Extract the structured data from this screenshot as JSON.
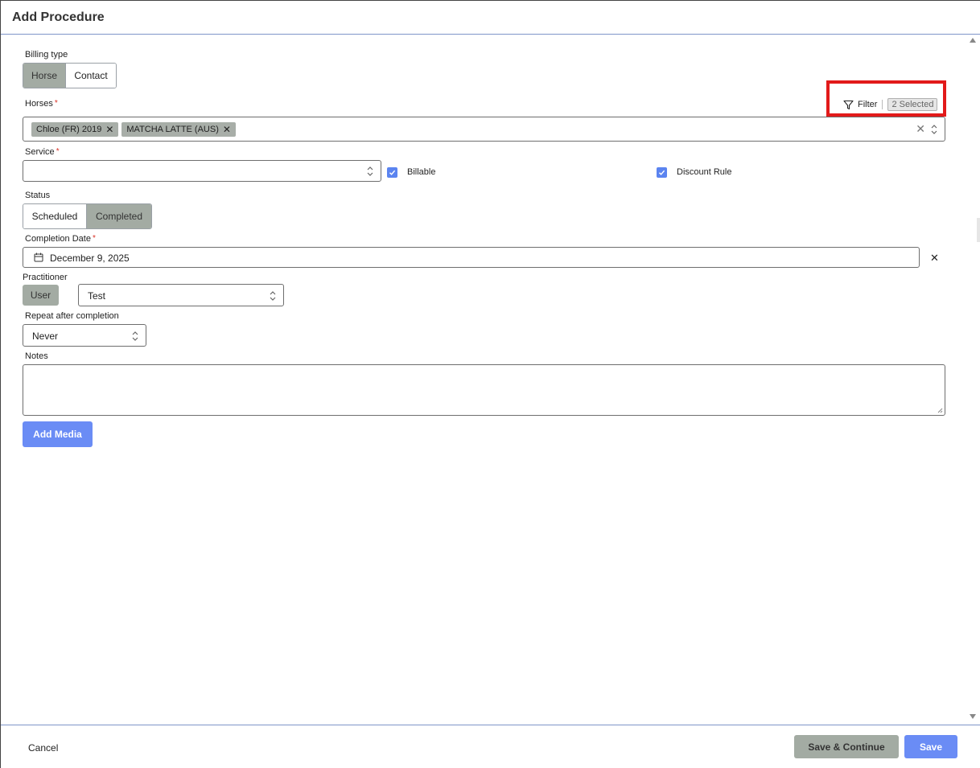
{
  "header": {
    "title": "Add Procedure"
  },
  "billing": {
    "label": "Billing type",
    "options": [
      "Horse",
      "Contact"
    ],
    "selected": "Horse"
  },
  "horses": {
    "label": "Horses",
    "required": "*",
    "filter_label": "Filter",
    "selected_count": "2 Selected",
    "chips": [
      "Chloe (FR) 2019",
      "MATCHA LATTE (AUS)"
    ]
  },
  "service": {
    "label": "Service",
    "required": "*",
    "value": ""
  },
  "checkboxes": {
    "billable": "Billable",
    "discount_rule": "Discount Rule"
  },
  "status": {
    "label": "Status",
    "options": [
      "Scheduled",
      "Completed"
    ],
    "selected": "Completed"
  },
  "completion": {
    "label": "Completion Date",
    "required": "*",
    "value": "December 9, 2025"
  },
  "practitioner": {
    "label": "Practitioner",
    "type_button": "User",
    "value": "Test"
  },
  "repeat": {
    "label": "Repeat after completion",
    "value": "Never"
  },
  "notes": {
    "label": "Notes",
    "value": ""
  },
  "media": {
    "button": "Add Media"
  },
  "footer": {
    "cancel": "Cancel",
    "save_continue": "Save & Continue",
    "save": "Save"
  },
  "colors": {
    "primary": "#6a8cf5",
    "secondary": "#a3aba3",
    "highlight": "#e21a1a",
    "required": "#d93025"
  }
}
